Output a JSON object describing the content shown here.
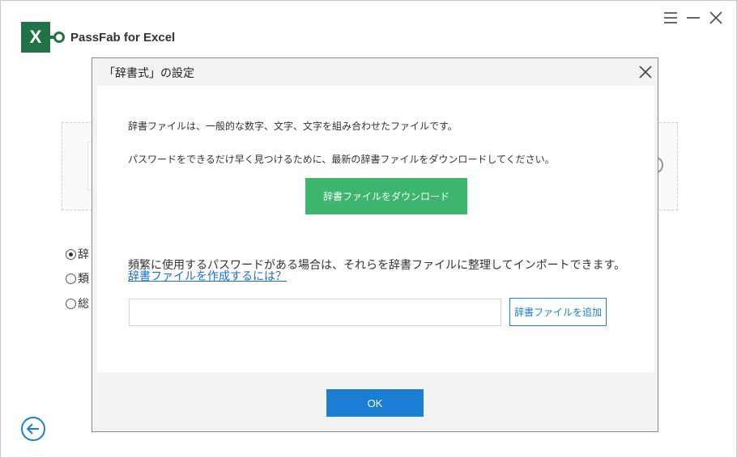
{
  "app": {
    "logo_letter": "X",
    "title": "PassFab for Excel",
    "brand_color": "#217346"
  },
  "window_controls": {
    "menu_icon": "hamburger-icon",
    "minimize_icon": "minimize-icon",
    "close_icon": "close-icon"
  },
  "background": {
    "radio_options": [
      {
        "label": "辞",
        "checked": true
      },
      {
        "label": "類",
        "checked": false
      },
      {
        "label": "総",
        "checked": false
      }
    ],
    "back_icon": "arrow-left-icon"
  },
  "dialog": {
    "title": "「辞書式」の設定",
    "description_1": "辞書ファイルは、一般的な数字、文字、文字を組み合わせたファイルです。",
    "description_2": "パスワードをできるだけ早く見つけるために、最新の辞書ファイルをダウンロードしてください。",
    "download_button": "辞書ファイルをダウンロード",
    "description_3": "頻繁に使用するパスワードがある場合は、それらを辞書ファイルに整理してインポートできます。",
    "help_link": "辞書ファイルを作成するには？",
    "path_input": {
      "value": "",
      "placeholder": ""
    },
    "add_button": "辞書ファイルを追加",
    "ok_button": "OK"
  },
  "colors": {
    "accent": "#1a7fd4",
    "download_green": "#3cb66e"
  }
}
